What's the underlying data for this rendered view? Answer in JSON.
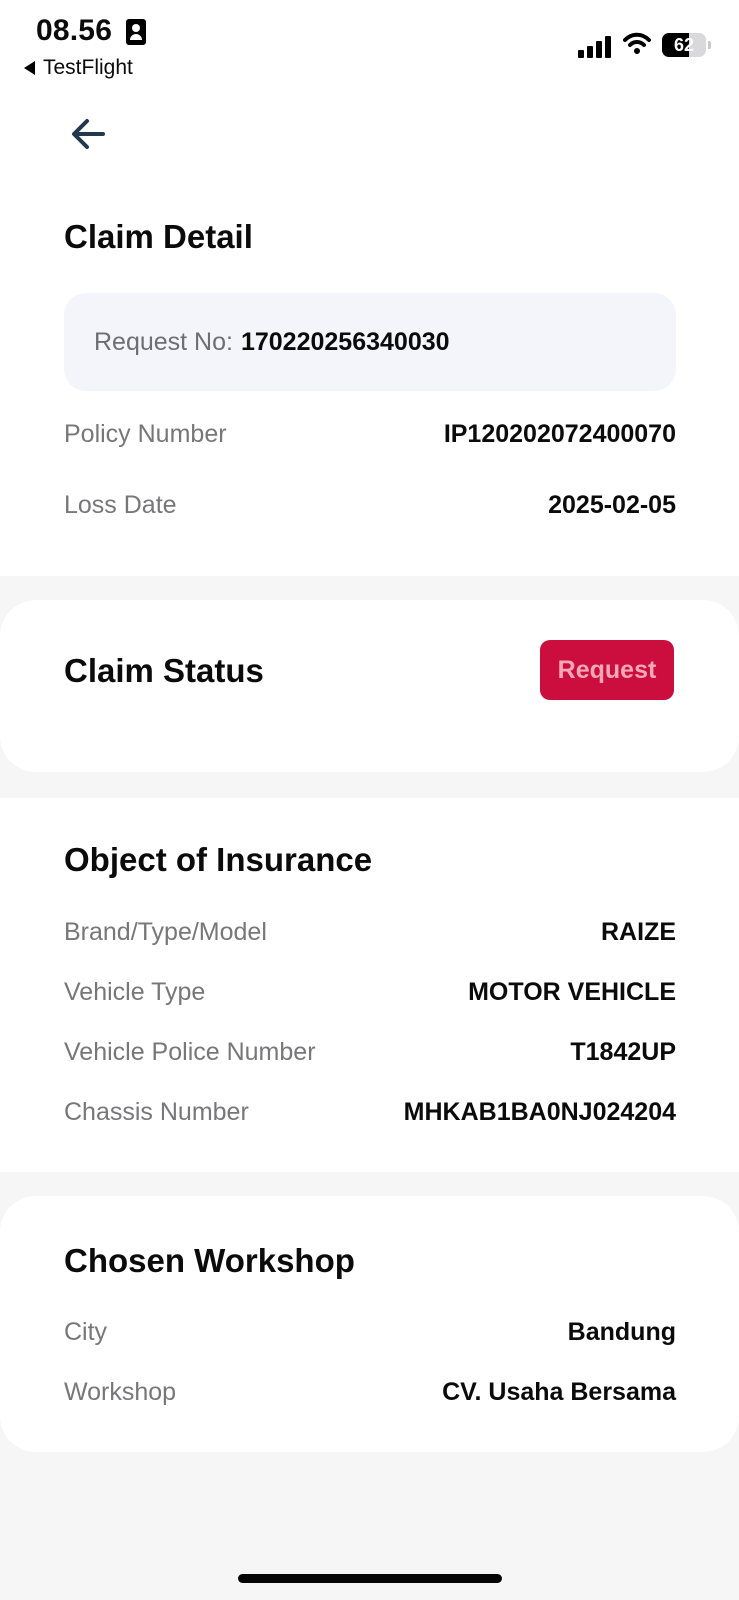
{
  "status_bar": {
    "time": "08.56",
    "back_app": "TestFlight",
    "battery": "62"
  },
  "header": {
    "title": "Claim Detail"
  },
  "request": {
    "label": "Request No:",
    "value": "170220256340030"
  },
  "claim_info": [
    {
      "label": "Policy Number",
      "value": "IP120202072400070"
    },
    {
      "label": "Loss Date",
      "value": "2025-02-05"
    }
  ],
  "claim_status": {
    "title": "Claim Status",
    "badge": "Request",
    "badge_color": "#cc0e3f"
  },
  "object_of_insurance": {
    "title": "Object of Insurance",
    "rows": [
      {
        "label": "Brand/Type/Model",
        "value": "RAIZE"
      },
      {
        "label": "Vehicle Type",
        "value": "MOTOR VEHICLE"
      },
      {
        "label": "Vehicle Police Number",
        "value": "T1842UP"
      },
      {
        "label": "Chassis Number",
        "value": "MHKAB1BA0NJ024204"
      }
    ]
  },
  "chosen_workshop": {
    "title": "Chosen Workshop",
    "rows": [
      {
        "label": "City",
        "value": "Bandung"
      },
      {
        "label": "Workshop",
        "value": "CV. Usaha Bersama"
      }
    ]
  },
  "icons": {
    "back": "arrow-left-icon",
    "signal": "cellular-signal-icon",
    "wifi": "wifi-icon",
    "battery": "battery-icon",
    "id": "id-card-icon"
  }
}
